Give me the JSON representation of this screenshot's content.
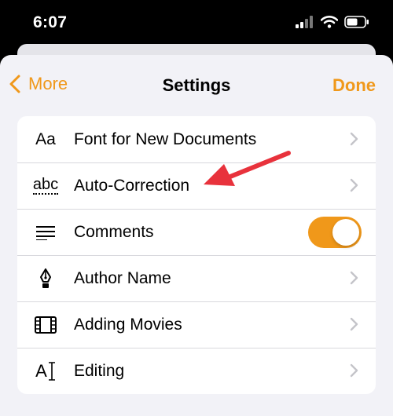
{
  "status_bar": {
    "time": "6:07"
  },
  "nav": {
    "back_label": "More",
    "title": "Settings",
    "done_label": "Done"
  },
  "settings_rows": [
    {
      "label": "Font for New Documents",
      "icon": "font-aa-icon",
      "icon_text": "Aa",
      "accessory": "chevron"
    },
    {
      "label": "Auto-Correction",
      "icon": "spellcheck-abc-icon",
      "icon_text": "abc",
      "accessory": "chevron"
    },
    {
      "label": "Comments",
      "icon": "comments-lines-icon",
      "accessory": "toggle",
      "toggle_on": true
    },
    {
      "label": "Author Name",
      "icon": "pen-nib-icon",
      "accessory": "chevron"
    },
    {
      "label": "Adding Movies",
      "icon": "film-strip-icon",
      "accessory": "chevron"
    },
    {
      "label": "Editing",
      "icon": "text-cursor-icon",
      "icon_text": "A",
      "accessory": "chevron"
    }
  ],
  "colors": {
    "accent": "#f0981a",
    "annotation": "#e8323c",
    "background": "#f2f2f7"
  }
}
